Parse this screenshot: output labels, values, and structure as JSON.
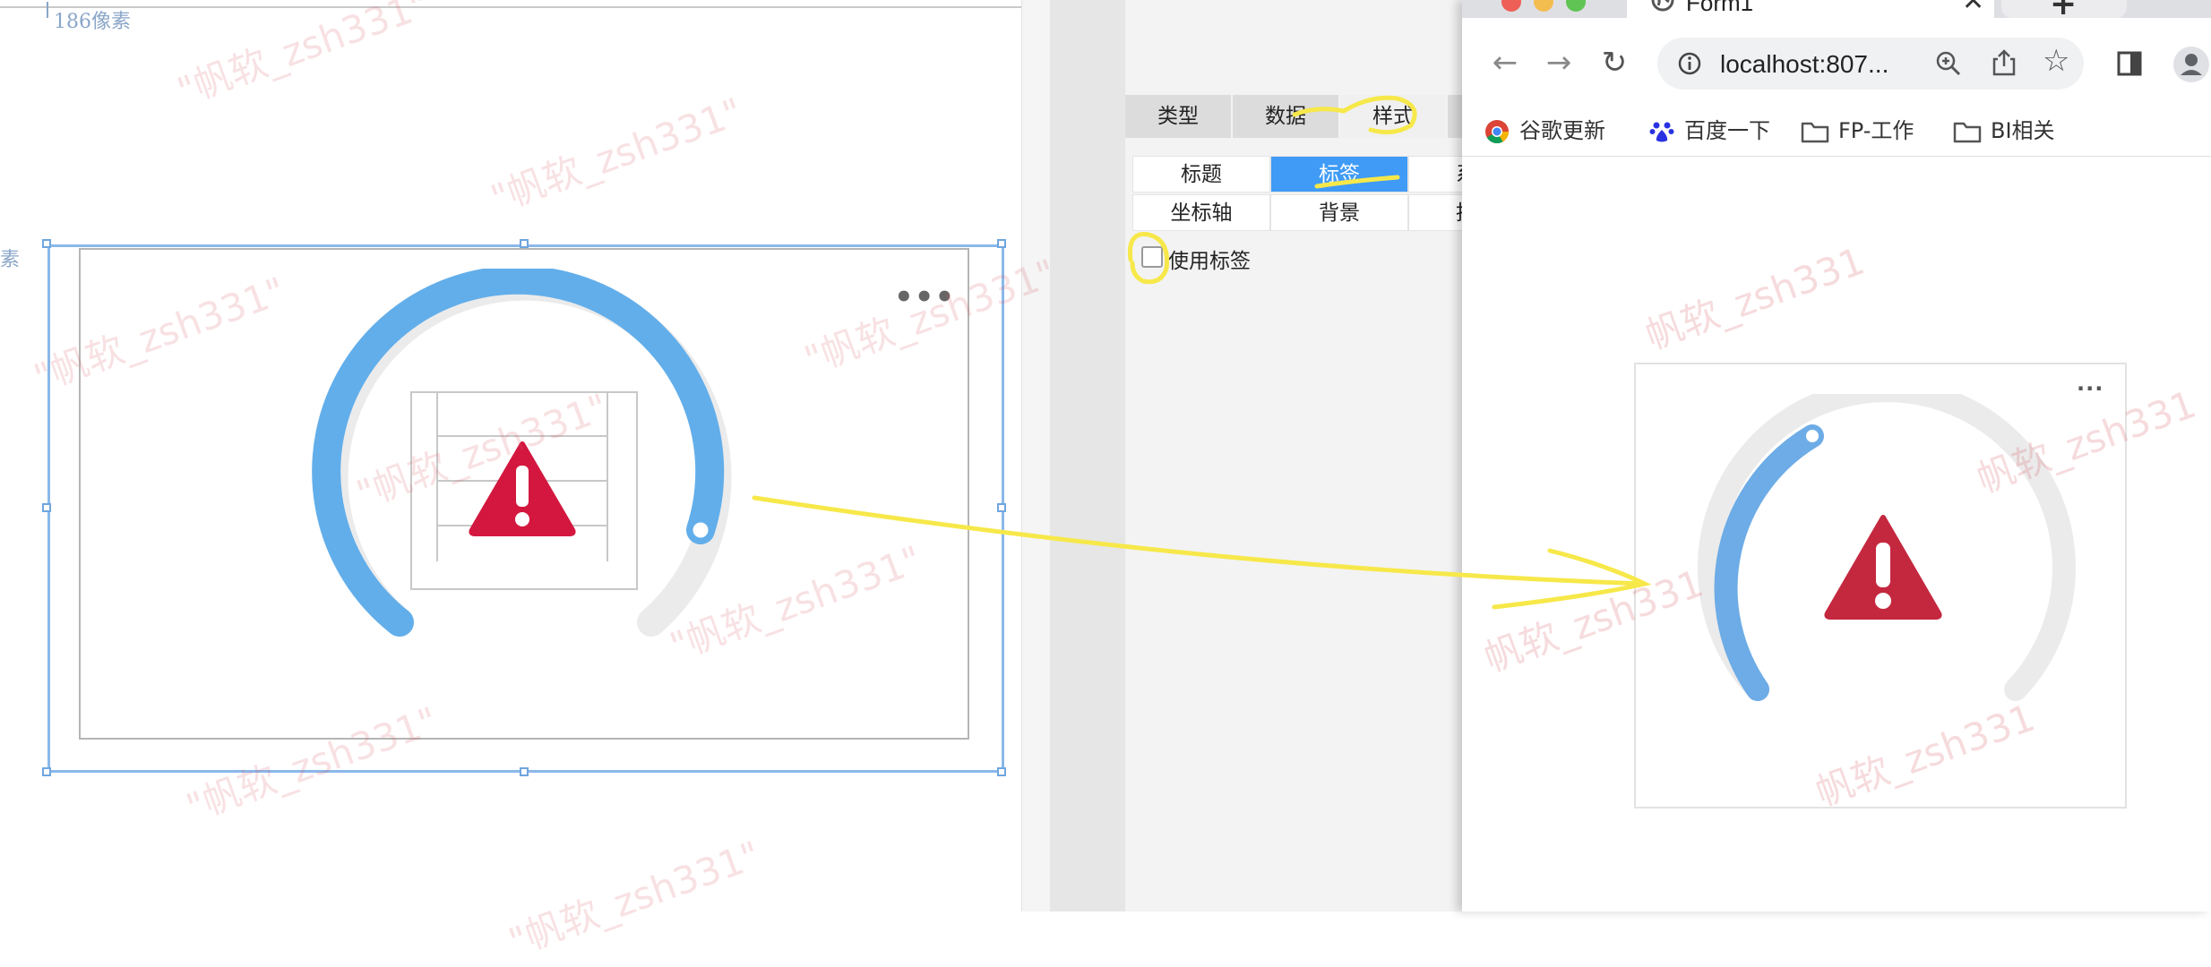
{
  "designer": {
    "ruler_top_label": "186像素",
    "ruler_left_label": "素",
    "more_label": "•••"
  },
  "panel": {
    "tabs": [
      {
        "label": "类型"
      },
      {
        "label": "数据"
      },
      {
        "label": "样式"
      }
    ],
    "sub_tabs": [
      {
        "label": "标题"
      },
      {
        "label": "标签"
      },
      {
        "label": "系"
      },
      {
        "label": "坐标轴"
      },
      {
        "label": "背景"
      },
      {
        "label": "拍"
      }
    ],
    "use_label_checkbox": {
      "label": "使用标签",
      "checked": false
    }
  },
  "browser": {
    "tab_title": "Form1",
    "new_tab_label": "+",
    "url": "localhost:807...",
    "bookmarks": [
      {
        "label": "谷歌更新",
        "icon": "chrome-icon"
      },
      {
        "label": "百度一下",
        "icon": "baidu-paw-icon"
      },
      {
        "label": "FP-工作",
        "icon": "folder-icon"
      },
      {
        "label": "BI相关",
        "icon": "folder-icon"
      }
    ],
    "more_label": "···"
  },
  "watermark_text": "\"帆软_zsh331\"",
  "watermark_text_plain": "帆软_zsh331",
  "colors": {
    "gauge_blue": "#62aeea",
    "gauge_grey": "#ebebeb",
    "warning_red": "#d3173f",
    "browser_warning_red": "#c4283f",
    "selection_blue": "#8ab8ea",
    "active_subtab": "#3f9bf6",
    "annotation_yellow": "#f7e84a"
  }
}
